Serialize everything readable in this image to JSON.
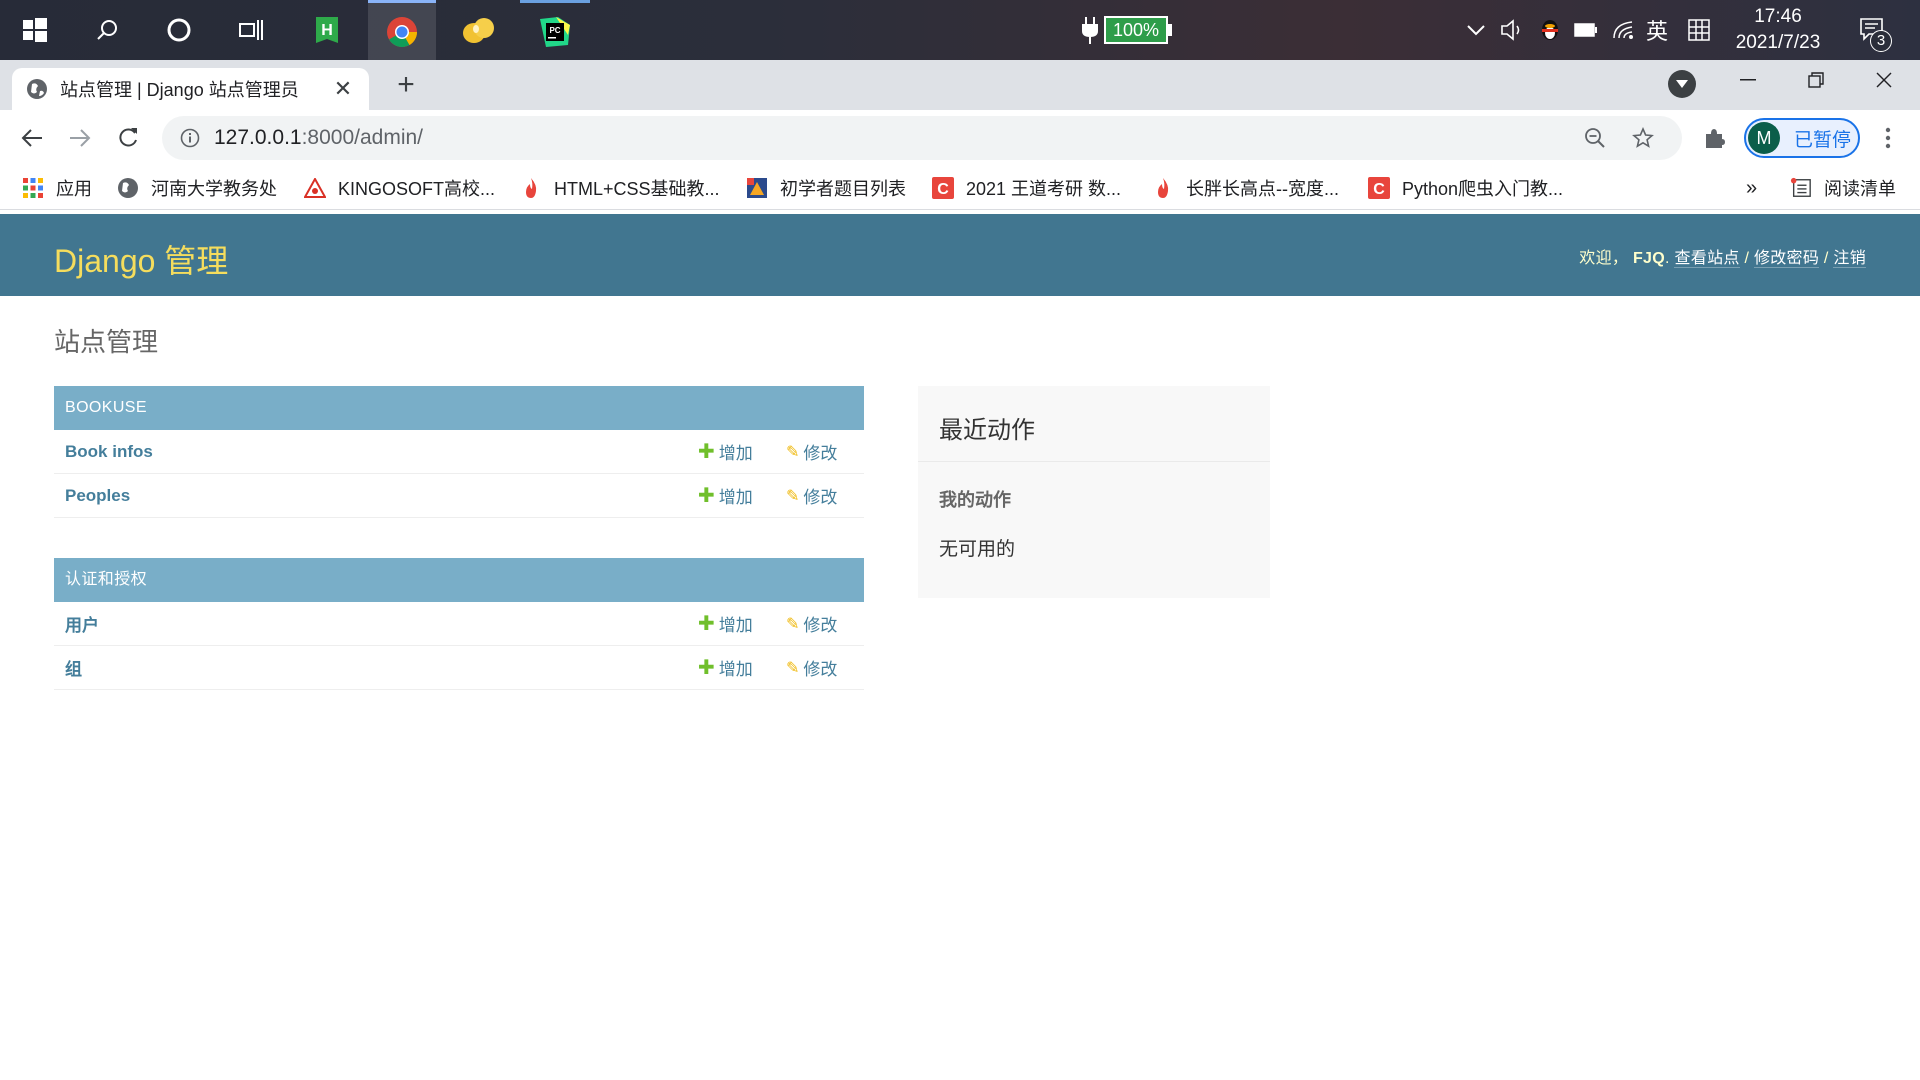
{
  "taskbar": {
    "battery": "100%",
    "ime": "英",
    "time": "17:46",
    "date": "2021/7/23",
    "notification_count": "3"
  },
  "browser": {
    "tab_title": "站点管理 | Django 站点管理员",
    "url_host": "127.0.0.1",
    "url_rest": ":8000/admin/",
    "profile_initial": "M",
    "profile_label": "已暂停",
    "bookmarks": [
      "应用",
      "河南大学教务处",
      "KINGOSOFT高校...",
      "HTML+CSS基础教...",
      "初学者题目列表",
      "2021 王道考研 数...",
      "长胖长高点--宽度...",
      "Python爬虫入门教..."
    ],
    "reading_list": "阅读清单",
    "overflow": "»"
  },
  "admin": {
    "branding": "Django 管理",
    "welcome": "欢迎，",
    "username": "FJQ",
    "view_site": "查看站点",
    "change_password": "修改密码",
    "logout": "注销",
    "separator": "/",
    "page_title": "站点管理",
    "add_label": "增加",
    "change_label": "修改",
    "apps": [
      {
        "caption": "BOOKUSE",
        "models": [
          "Book infos",
          "Peoples"
        ]
      },
      {
        "caption": "认证和授权",
        "models": [
          "用户",
          "组"
        ]
      }
    ],
    "recent_actions": {
      "title": "最近动作",
      "my_actions": "我的动作",
      "empty": "无可用的"
    }
  },
  "colors": {
    "header": "#417690",
    "branding": "#f5dd5d",
    "module_caption": "#79aec8",
    "link": "#447e9b",
    "add_icon": "#70bf2b",
    "change_icon": "#efb80b"
  }
}
